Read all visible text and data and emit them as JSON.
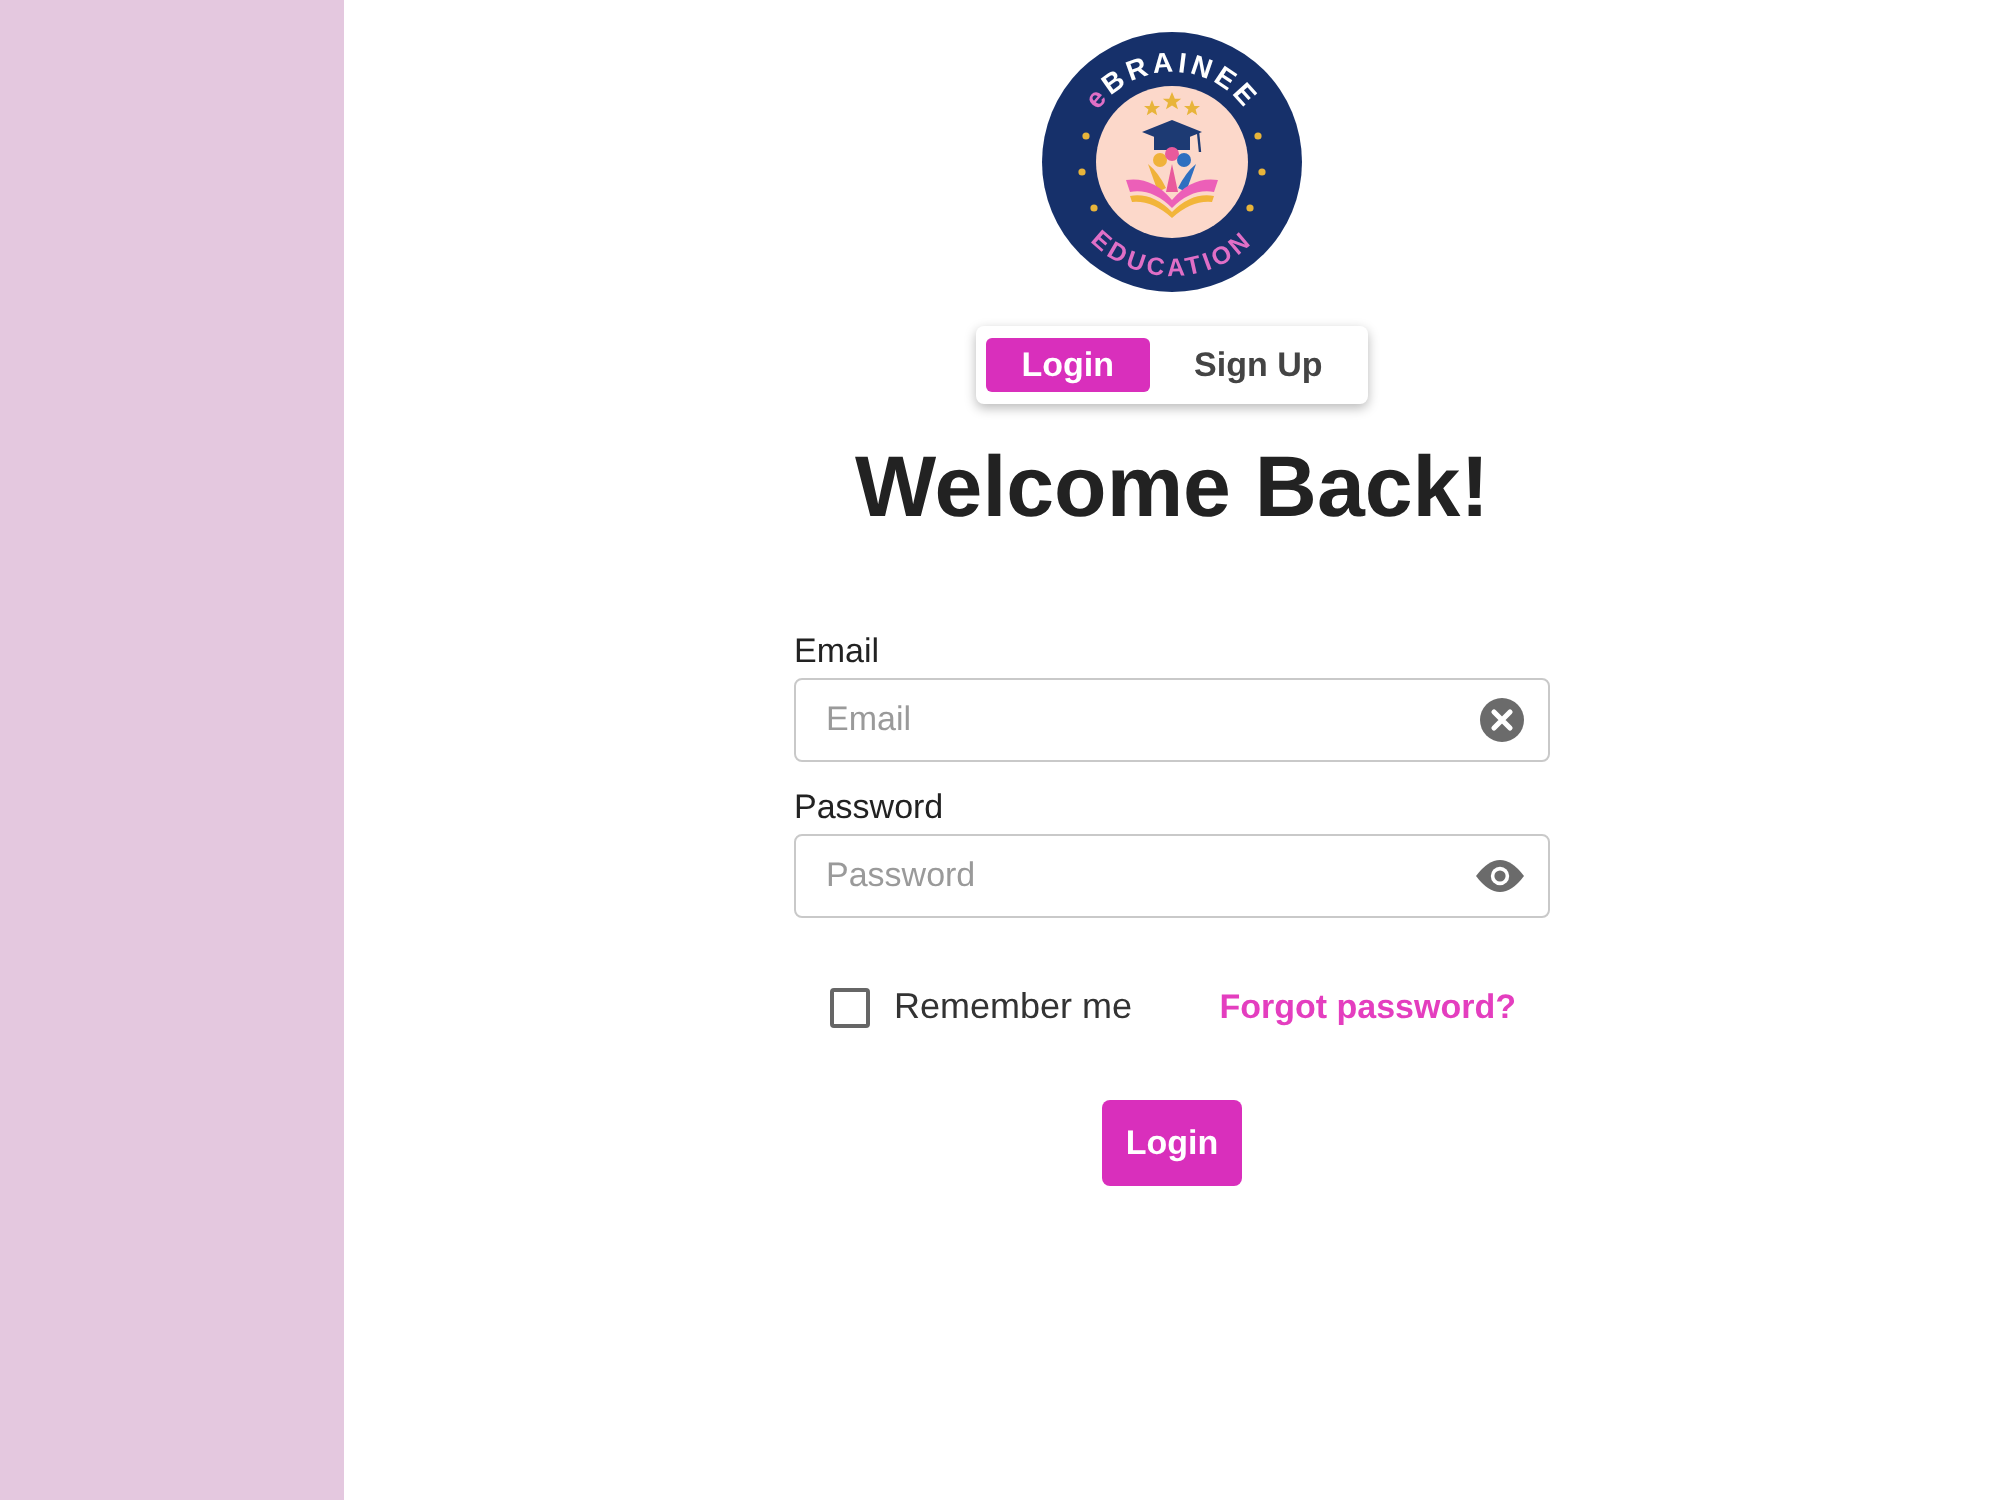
{
  "logo": {
    "brand_prefix": "e",
    "brand": "BRAINEE",
    "tagline": "EDUCATION"
  },
  "tabs": [
    {
      "label": "Login",
      "selected": true
    },
    {
      "label": "Sign Up",
      "selected": false
    }
  ],
  "heading": "Welcome Back!",
  "fields": [
    {
      "label": "Email",
      "placeholder": "Email",
      "kind": "clear"
    },
    {
      "label": "Password",
      "placeholder": "Password",
      "kind": "reveal"
    }
  ],
  "remember": {
    "label": "Remember me",
    "checked": false
  },
  "forgot_link": "Forgot password?",
  "submit": "Login"
}
